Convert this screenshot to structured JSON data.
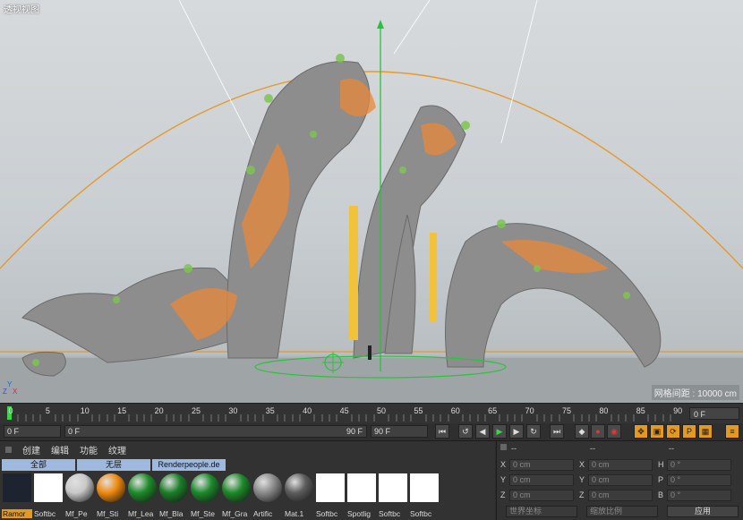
{
  "viewport": {
    "label": "透视视图",
    "grid_distance": "网格间距 : 10000 cm",
    "axes": {
      "x": "X",
      "y": "Y",
      "z": "Z"
    }
  },
  "timeline": {
    "ticks": [
      "0",
      "5",
      "10",
      "15",
      "20",
      "25",
      "30",
      "35",
      "40",
      "45",
      "50",
      "55",
      "60",
      "65",
      "70",
      "75",
      "80",
      "85",
      "90"
    ],
    "current_frame": "0 F"
  },
  "transport": {
    "start": "0 F",
    "range_start": "0 F",
    "range_end": "90 F",
    "end": "90 F"
  },
  "material_manager": {
    "menu": [
      "创建",
      "编辑",
      "功能",
      "纹理"
    ],
    "tabs": [
      "全部",
      "无层",
      "Renderpeople.de"
    ],
    "materials": [
      {
        "name": "Ramor",
        "color": "#1e2330"
      },
      {
        "name": "Softbc",
        "color": "#ffffff"
      },
      {
        "name": "Mf_Pe",
        "color": "#c9c9c9"
      },
      {
        "name": "Mf_Sti",
        "color": "#f08a10"
      },
      {
        "name": "Mf_Lea",
        "color": "#1f8c2a"
      },
      {
        "name": "Mf_Bla",
        "color": "#1c7f28"
      },
      {
        "name": "Mf_Ste",
        "color": "#1c8a2c"
      },
      {
        "name": "Mf_Gra",
        "color": "#1e8a2a"
      },
      {
        "name": "Artific",
        "color": "#8a8a8a"
      },
      {
        "name": "Mat.1",
        "color": "#5d5d5d"
      },
      {
        "name": "Softbc",
        "color": "#ffffff"
      },
      {
        "name": "Spotlig",
        "color": "#ffffff"
      },
      {
        "name": "Softbc",
        "color": "#ffffff"
      },
      {
        "name": "Softbc",
        "color": "#ffffff"
      }
    ]
  },
  "coordinates": {
    "headers": [
      "--",
      "--",
      "--"
    ],
    "rows": [
      {
        "a": "X",
        "av": "0 cm",
        "b": "X",
        "bv": "0 cm",
        "c": "H",
        "cv": "0 °"
      },
      {
        "a": "Y",
        "av": "0 cm",
        "b": "Y",
        "bv": "0 cm",
        "c": "P",
        "cv": "0 °"
      },
      {
        "a": "Z",
        "av": "0 cm",
        "b": "Z",
        "bv": "0 cm",
        "c": "B",
        "cv": "0 °"
      }
    ],
    "mode1": "世界坐标",
    "mode2": "缩放比例",
    "apply": "应用"
  },
  "colors": {
    "accent": "#e39a1e",
    "playhead": "#3cd34e",
    "tab": "#9fb8dd"
  }
}
